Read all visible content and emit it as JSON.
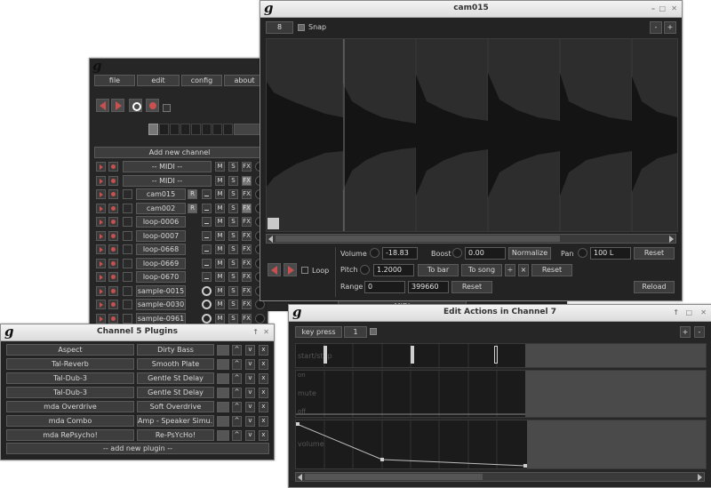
{
  "main_window": {
    "menu": [
      "file",
      "edit",
      "config",
      "about"
    ],
    "add_channel_label": "Add new channel",
    "channels": [
      {
        "name": "-- MIDI --",
        "type": "midi"
      },
      {
        "name": "-- MIDI --",
        "type": "midi"
      },
      {
        "name": "cam015",
        "type": "sample",
        "r": "R"
      },
      {
        "name": "cam002",
        "type": "sample",
        "r": "R"
      },
      {
        "name": "loop-0006",
        "type": "sample"
      },
      {
        "name": "loop-0007",
        "type": "sample"
      },
      {
        "name": "loop-0668",
        "type": "sample"
      },
      {
        "name": "loop-0669",
        "type": "sample"
      },
      {
        "name": "loop-0670",
        "type": "sample"
      },
      {
        "name": "sample-0015",
        "type": "sample"
      },
      {
        "name": "sample-0030",
        "type": "sample"
      },
      {
        "name": "sample-0961",
        "type": "sample"
      }
    ],
    "m_label": "M",
    "s_label": "S",
    "fx_label": "FX"
  },
  "sample_editor": {
    "title": "cam015",
    "grid_value": "8",
    "snap_label": "Snap",
    "zoom_out": "-",
    "zoom_in": "+",
    "volume_label": "Volume",
    "volume_value": "-18.83",
    "boost_label": "Boost",
    "boost_value": "0.00",
    "normalize_label": "Normalize",
    "pan_label": "Pan",
    "pan_value": "100 L",
    "reset_label": "Reset",
    "loop_label": "Loop",
    "pitch_label": "Pitch",
    "pitch_value": "1.2000",
    "to_bar_label": "To bar",
    "to_song_label": "To song",
    "half_label": "÷",
    "double_label": "×",
    "range_label": "Range",
    "range_start": "0",
    "range_end": "399660",
    "reload_label": "Reload"
  },
  "plugins_window": {
    "title": "Channel 5 Plugins",
    "plugins": [
      {
        "name": "Aspect",
        "preset": "Dirty Bass"
      },
      {
        "name": "Tal-Reverb",
        "preset": "Smooth Plate"
      },
      {
        "name": "Tal-Dub-3",
        "preset": "Gentle St Delay"
      },
      {
        "name": "Tal-Dub-3",
        "preset": "Gentle St Delay"
      },
      {
        "name": "mda Overdrive",
        "preset": "Soft Overdrive"
      },
      {
        "name": "mda Combo",
        "preset": "Amp - Speaker Simu..."
      },
      {
        "name": "mda RePsycho!",
        "preset": "Re-PsYcHo!"
      }
    ],
    "up_label": "^",
    "down_label": "v",
    "remove_label": "x",
    "add_plugin_label": "-- add new plugin --"
  },
  "actions_window": {
    "title": "Edit Actions in Channel 7",
    "action_type": "key press",
    "grid_value": "1",
    "zoom_in": "+",
    "zoom_out": "-",
    "lanes": [
      {
        "label": "start/stop"
      },
      {
        "label": "mute",
        "on_label": "on",
        "off_label": "off"
      },
      {
        "label": "volume"
      }
    ]
  },
  "background_window": {
    "midi_label": "-- MIDI --"
  }
}
